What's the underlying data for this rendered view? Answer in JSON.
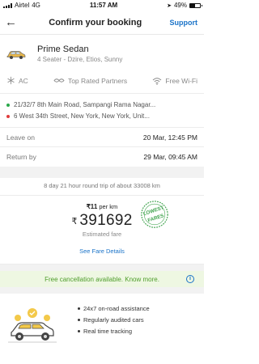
{
  "status_bar": {
    "carrier": "Airtel",
    "network": "4G",
    "time": "11:57 AM",
    "battery_pct": "49%",
    "battery_level": 0.49
  },
  "header": {
    "title": "Confirm your booking",
    "support_label": "Support"
  },
  "car": {
    "name": "Prime Sedan",
    "description": "4 Seater - Dzire, Etios, Sunny"
  },
  "features": [
    {
      "icon": "snowflake-icon",
      "label": "AC"
    },
    {
      "icon": "badge-icon",
      "label": "Top Rated Partners"
    },
    {
      "icon": "wifi-icon",
      "label": "Free Wi-Fi"
    }
  ],
  "route": {
    "pickup": "21/32/7 8th Main Road, Sampangi Rama Nagar...",
    "drop": "6 West 34th Street, New York, New York, Unit..."
  },
  "trip": {
    "leave_label": "Leave on",
    "leave_value": "20 Mar, 12:45 PM",
    "return_label": "Return by",
    "return_value": "29 Mar, 09:45 AM"
  },
  "summary": "8 day 21 hour round trip of about 33008 km",
  "fare": {
    "per_km_amount": "₹11",
    "per_km_unit": "per km",
    "currency": "₹",
    "amount": "391692",
    "estimated_label": "Estimated fare",
    "stamp_top": "LOWEST",
    "stamp_bottom": "FARES"
  },
  "fare_details_link": "See Fare Details",
  "cancellation": {
    "text": "Free cancellation available. Know more.",
    "info_icon": "i"
  },
  "assurances": [
    "24x7 on-road assistance",
    "Regularly audited cars",
    "Real time tracking"
  ],
  "colors": {
    "link_blue": "#1a73c8",
    "success_green": "#4e9d2b",
    "success_bg": "#eef7e2"
  }
}
